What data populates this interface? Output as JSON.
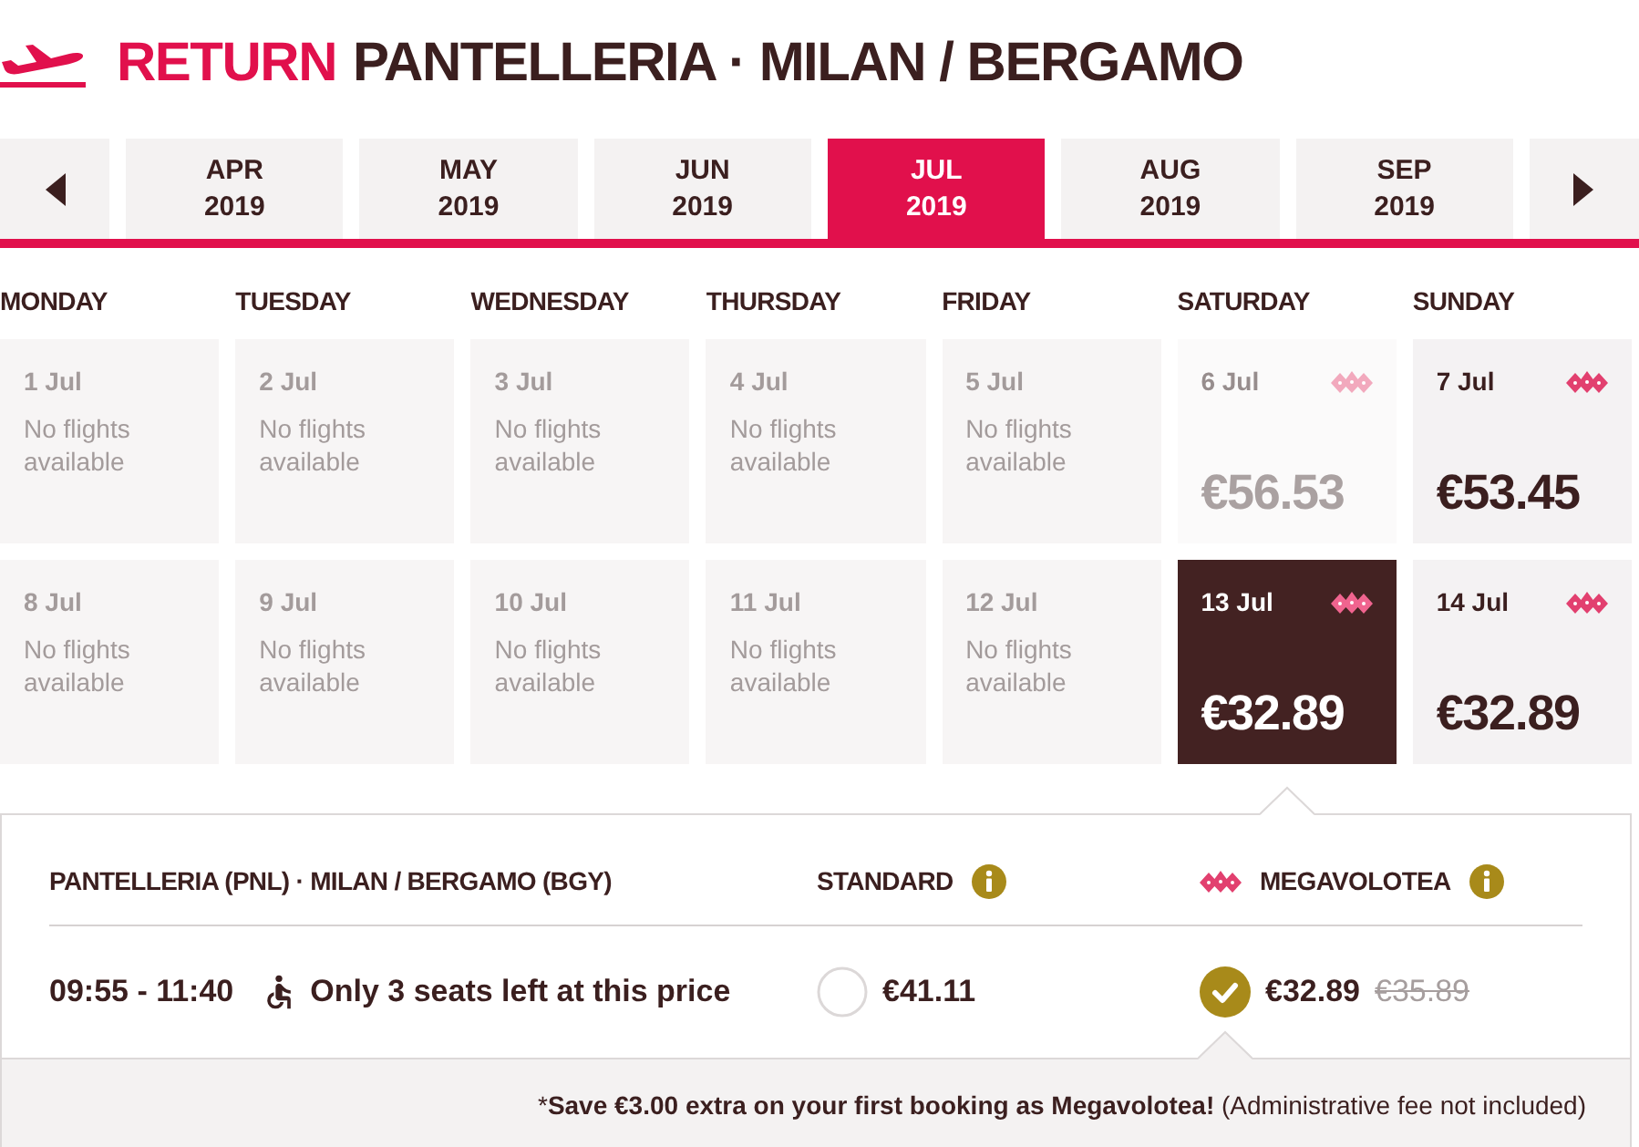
{
  "header": {
    "trip_type": "RETURN",
    "route": "PANTELLERIA · MILAN / BERGAMO"
  },
  "months": [
    {
      "month": "APR",
      "year": "2019",
      "selected": false
    },
    {
      "month": "MAY",
      "year": "2019",
      "selected": false
    },
    {
      "month": "JUN",
      "year": "2019",
      "selected": false
    },
    {
      "month": "JUL",
      "year": "2019",
      "selected": true
    },
    {
      "month": "AUG",
      "year": "2019",
      "selected": false
    },
    {
      "month": "SEP",
      "year": "2019",
      "selected": false
    }
  ],
  "weekdays": [
    "MONDAY",
    "TUESDAY",
    "WEDNESDAY",
    "THURSDAY",
    "FRIDAY",
    "SATURDAY",
    "SUNDAY"
  ],
  "days": [
    {
      "kind": "no_flights",
      "date": "1 Jul",
      "note": "No flights available",
      "selected": false
    },
    {
      "kind": "no_flights",
      "date": "2 Jul",
      "note": "No flights available",
      "selected": false
    },
    {
      "kind": "no_flights",
      "date": "3 Jul",
      "note": "No flights available",
      "selected": false
    },
    {
      "kind": "no_flights",
      "date": "4 Jul",
      "note": "No flights available",
      "selected": false
    },
    {
      "kind": "no_flights",
      "date": "5 Jul",
      "note": "No flights available",
      "selected": false
    },
    {
      "kind": "fare",
      "date": "6 Jul",
      "price": "€56.53",
      "megavolotea": true,
      "disabled": true,
      "selected": false
    },
    {
      "kind": "fare",
      "date": "7 Jul",
      "price": "€53.45",
      "megavolotea": true,
      "disabled": false,
      "selected": false
    },
    {
      "kind": "no_flights",
      "date": "8 Jul",
      "note": "No flights available",
      "selected": false
    },
    {
      "kind": "no_flights",
      "date": "9 Jul",
      "note": "No flights available",
      "selected": false
    },
    {
      "kind": "no_flights",
      "date": "10 Jul",
      "note": "No flights available",
      "selected": false
    },
    {
      "kind": "no_flights",
      "date": "11 Jul",
      "note": "No flights available",
      "selected": false
    },
    {
      "kind": "no_flights",
      "date": "12 Jul",
      "note": "No flights available",
      "selected": false
    },
    {
      "kind": "fare",
      "date": "13 Jul",
      "price": "€32.89",
      "megavolotea": true,
      "disabled": false,
      "selected": true
    },
    {
      "kind": "fare",
      "date": "14 Jul",
      "price": "€32.89",
      "megavolotea": true,
      "disabled": false,
      "selected": false
    }
  ],
  "flight": {
    "route": "PANTELLERIA (PNL) · MILAN / BERGAMO (BGY)",
    "times": "09:55 - 11:40",
    "seats_note": "Only 3 seats left at this price",
    "fares": [
      {
        "name": "STANDARD",
        "price": "€41.11",
        "megavolotea": false,
        "selected": false
      },
      {
        "name": "MEGAVOLOTEA",
        "price": "€32.89",
        "old_price": "€35.89",
        "megavolotea": true,
        "selected": true
      }
    ]
  },
  "promo": {
    "mark": "*",
    "text": "**Save €3.00 extra on your first booking as Megavolotea!** (Administrative fee not included)"
  }
}
